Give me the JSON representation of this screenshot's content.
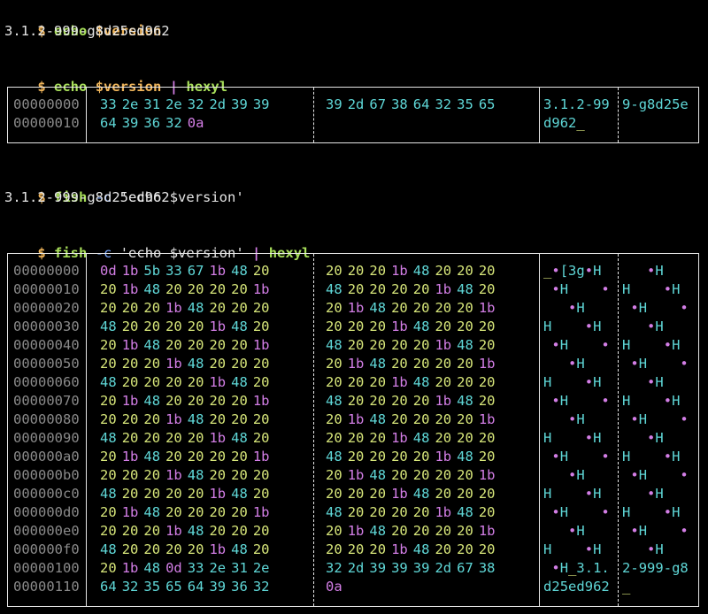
{
  "colors": {
    "prompt": "#f0b55a",
    "command": "#a8df5a",
    "pipe": "#d37ee6",
    "option": "#7aa8ff",
    "printable_byte": "#5fd7d7",
    "space_byte": "#d7e67a",
    "control_byte": "#d37ee6",
    "offset": "#8a8a8a"
  },
  "session": {
    "cmd1": {
      "prompt": "$",
      "cmd": "echo",
      "arg": "$version"
    },
    "out1": "3.1.2-999-g8d25ed962",
    "cmd2": {
      "prompt": "$",
      "cmd": "echo",
      "arg": "$version",
      "pipe": "|",
      "cmd2": "hexyl"
    },
    "cmd3": {
      "prompt": "$",
      "cmd": "fish",
      "opt": "-c",
      "str": "'echo $version'"
    },
    "out3": "3.1.2-999-g8d25ed962",
    "cmd4": {
      "prompt": "$",
      "cmd": "fish",
      "opt": "-c",
      "str": "'echo $version'",
      "pipe": "|",
      "cmd2": "hexyl"
    }
  },
  "hexdump1": {
    "rows": [
      {
        "offset": "00000000",
        "hex1": [
          "33",
          "2e",
          "31",
          "2e",
          "32",
          "2d",
          "39",
          "39"
        ],
        "hex2": [
          "39",
          "2d",
          "67",
          "38",
          "64",
          "32",
          "35",
          "65"
        ],
        "ascii1": "3.1.2-99",
        "ascii2": "9-g8d25e"
      },
      {
        "offset": "00000010",
        "hex1": [
          "64",
          "39",
          "36",
          "32",
          "0a"
        ],
        "hex2": [],
        "ascii1": "d962_",
        "ascii2": ""
      }
    ]
  },
  "hexdump2": {
    "rows": [
      {
        "offset": "00000000",
        "hex1": [
          "0d",
          "1b",
          "5b",
          "33",
          "67",
          "1b",
          "48",
          "20"
        ],
        "hex2": [
          "20",
          "20",
          "20",
          "1b",
          "48",
          "20",
          "20",
          "20"
        ],
        "ascii1": "_•[3g•H ",
        "ascii2": "   •H   "
      },
      {
        "offset": "00000010",
        "hex1": [
          "20",
          "1b",
          "48",
          "20",
          "20",
          "20",
          "20",
          "1b"
        ],
        "hex2": [
          "48",
          "20",
          "20",
          "20",
          "20",
          "1b",
          "48",
          "20"
        ],
        "ascii1": " •H    •",
        "ascii2": "H    •H "
      },
      {
        "offset": "00000020",
        "hex1": [
          "20",
          "20",
          "20",
          "1b",
          "48",
          "20",
          "20",
          "20"
        ],
        "hex2": [
          "20",
          "1b",
          "48",
          "20",
          "20",
          "20",
          "20",
          "1b"
        ],
        "ascii1": "   •H   ",
        "ascii2": " •H    •"
      },
      {
        "offset": "00000030",
        "hex1": [
          "48",
          "20",
          "20",
          "20",
          "20",
          "1b",
          "48",
          "20"
        ],
        "hex2": [
          "20",
          "20",
          "20",
          "1b",
          "48",
          "20",
          "20",
          "20"
        ],
        "ascii1": "H    •H ",
        "ascii2": "   •H   "
      },
      {
        "offset": "00000040",
        "hex1": [
          "20",
          "1b",
          "48",
          "20",
          "20",
          "20",
          "20",
          "1b"
        ],
        "hex2": [
          "48",
          "20",
          "20",
          "20",
          "20",
          "1b",
          "48",
          "20"
        ],
        "ascii1": " •H    •",
        "ascii2": "H    •H "
      },
      {
        "offset": "00000050",
        "hex1": [
          "20",
          "20",
          "20",
          "1b",
          "48",
          "20",
          "20",
          "20"
        ],
        "hex2": [
          "20",
          "1b",
          "48",
          "20",
          "20",
          "20",
          "20",
          "1b"
        ],
        "ascii1": "   •H   ",
        "ascii2": " •H    •"
      },
      {
        "offset": "00000060",
        "hex1": [
          "48",
          "20",
          "20",
          "20",
          "20",
          "1b",
          "48",
          "20"
        ],
        "hex2": [
          "20",
          "20",
          "20",
          "1b",
          "48",
          "20",
          "20",
          "20"
        ],
        "ascii1": "H    •H ",
        "ascii2": "   •H   "
      },
      {
        "offset": "00000070",
        "hex1": [
          "20",
          "1b",
          "48",
          "20",
          "20",
          "20",
          "20",
          "1b"
        ],
        "hex2": [
          "48",
          "20",
          "20",
          "20",
          "20",
          "1b",
          "48",
          "20"
        ],
        "ascii1": " •H    •",
        "ascii2": "H    •H "
      },
      {
        "offset": "00000080",
        "hex1": [
          "20",
          "20",
          "20",
          "1b",
          "48",
          "20",
          "20",
          "20"
        ],
        "hex2": [
          "20",
          "1b",
          "48",
          "20",
          "20",
          "20",
          "20",
          "1b"
        ],
        "ascii1": "   •H   ",
        "ascii2": " •H    •"
      },
      {
        "offset": "00000090",
        "hex1": [
          "48",
          "20",
          "20",
          "20",
          "20",
          "1b",
          "48",
          "20"
        ],
        "hex2": [
          "20",
          "20",
          "20",
          "1b",
          "48",
          "20",
          "20",
          "20"
        ],
        "ascii1": "H    •H ",
        "ascii2": "   •H   "
      },
      {
        "offset": "000000a0",
        "hex1": [
          "20",
          "1b",
          "48",
          "20",
          "20",
          "20",
          "20",
          "1b"
        ],
        "hex2": [
          "48",
          "20",
          "20",
          "20",
          "20",
          "1b",
          "48",
          "20"
        ],
        "ascii1": " •H    •",
        "ascii2": "H    •H "
      },
      {
        "offset": "000000b0",
        "hex1": [
          "20",
          "20",
          "20",
          "1b",
          "48",
          "20",
          "20",
          "20"
        ],
        "hex2": [
          "20",
          "1b",
          "48",
          "20",
          "20",
          "20",
          "20",
          "1b"
        ],
        "ascii1": "   •H   ",
        "ascii2": " •H    •"
      },
      {
        "offset": "000000c0",
        "hex1": [
          "48",
          "20",
          "20",
          "20",
          "20",
          "1b",
          "48",
          "20"
        ],
        "hex2": [
          "20",
          "20",
          "20",
          "1b",
          "48",
          "20",
          "20",
          "20"
        ],
        "ascii1": "H    •H ",
        "ascii2": "   •H   "
      },
      {
        "offset": "000000d0",
        "hex1": [
          "20",
          "1b",
          "48",
          "20",
          "20",
          "20",
          "20",
          "1b"
        ],
        "hex2": [
          "48",
          "20",
          "20",
          "20",
          "20",
          "1b",
          "48",
          "20"
        ],
        "ascii1": " •H    •",
        "ascii2": "H    •H "
      },
      {
        "offset": "000000e0",
        "hex1": [
          "20",
          "20",
          "20",
          "1b",
          "48",
          "20",
          "20",
          "20"
        ],
        "hex2": [
          "20",
          "1b",
          "48",
          "20",
          "20",
          "20",
          "20",
          "1b"
        ],
        "ascii1": "   •H   ",
        "ascii2": " •H    •"
      },
      {
        "offset": "000000f0",
        "hex1": [
          "48",
          "20",
          "20",
          "20",
          "20",
          "1b",
          "48",
          "20"
        ],
        "hex2": [
          "20",
          "20",
          "20",
          "1b",
          "48",
          "20",
          "20",
          "20"
        ],
        "ascii1": "H    •H ",
        "ascii2": "   •H   "
      },
      {
        "offset": "00000100",
        "hex1": [
          "20",
          "1b",
          "48",
          "0d",
          "33",
          "2e",
          "31",
          "2e"
        ],
        "hex2": [
          "32",
          "2d",
          "39",
          "39",
          "39",
          "2d",
          "67",
          "38"
        ],
        "ascii1": " •H_3.1.",
        "ascii2": "2-999-g8"
      },
      {
        "offset": "00000110",
        "hex1": [
          "64",
          "32",
          "35",
          "65",
          "64",
          "39",
          "36",
          "32"
        ],
        "hex2": [
          "0a"
        ],
        "ascii1": "d25ed962",
        "ascii2": "_"
      }
    ]
  }
}
